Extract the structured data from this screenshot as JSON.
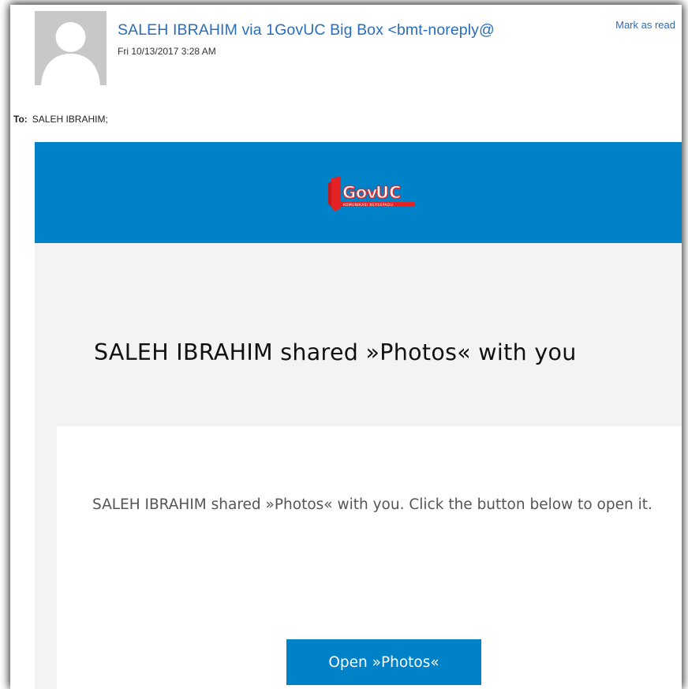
{
  "email": {
    "sender": "SALEH IBRAHIM via 1GovUC Big Box <bmt-noreply@",
    "date": "Fri 10/13/2017 3:28 AM",
    "mark_as_read": "Mark as read",
    "to_label": "To:",
    "to_value": "SALEH IBRAHIM;"
  },
  "banner": {
    "logo_text": "GovUC",
    "logo_tagline": "KOMUNIKASI BERSEPADU",
    "colors": {
      "banner": "#0082c9",
      "logo_red": "#e42327",
      "logo_blue": "#0082c9"
    }
  },
  "content": {
    "title": "SALEH IBRAHIM shared »Photos« with you",
    "message": "SALEH IBRAHIM shared »Photos« with you. Click the button below to open it.",
    "button_label": "Open »Photos«"
  }
}
